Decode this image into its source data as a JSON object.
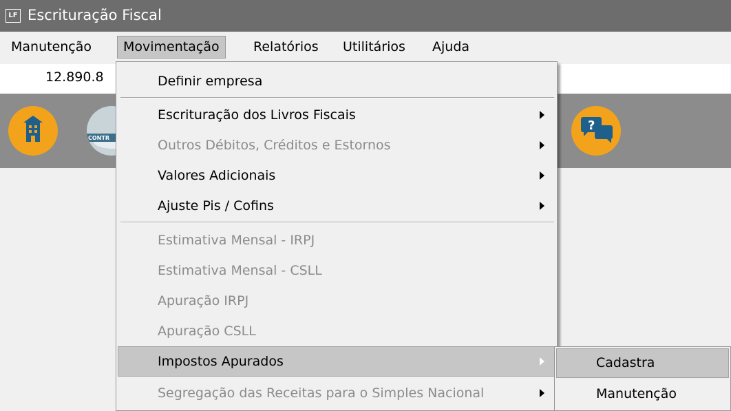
{
  "window": {
    "title": "Escrituração Fiscal",
    "icon_text": "LF"
  },
  "menubar": {
    "items": [
      {
        "label": "Manutenção"
      },
      {
        "label": "Movimentação"
      },
      {
        "label": "Relatórios"
      },
      {
        "label": "Utilitários"
      },
      {
        "label": "Ajuda"
      }
    ]
  },
  "infobar": {
    "cnpj_partial": "12.890.8"
  },
  "toolbar": {
    "icons": [
      "building-icon",
      "controle-icon",
      "help-chat-icon"
    ],
    "controle_text": "CONTR"
  },
  "dropdown": {
    "items": [
      {
        "label": "Definir empresa"
      },
      {
        "label": "Escrituração dos Livros Fiscais"
      },
      {
        "label": "Outros Débitos, Créditos e Estornos"
      },
      {
        "label": "Valores Adicionais"
      },
      {
        "label": "Ajuste Pis / Cofins"
      },
      {
        "label": "Estimativa Mensal - IRPJ"
      },
      {
        "label": "Estimativa Mensal - CSLL"
      },
      {
        "label": "Apuração IRPJ"
      },
      {
        "label": "Apuração CSLL"
      },
      {
        "label": "Impostos Apurados"
      },
      {
        "label": "Segregação das Receitas para o Simples Nacional"
      }
    ]
  },
  "submenu": {
    "items": [
      {
        "label": "Cadastra"
      },
      {
        "label": "Manutenção"
      }
    ]
  },
  "colors": {
    "titlebar": "#6d6d6d",
    "toolbar": "#8c8c8c",
    "icon_orange": "#f2a31b",
    "highlight": "#c6c6c6",
    "disabled_text": "#8b8b8b"
  }
}
